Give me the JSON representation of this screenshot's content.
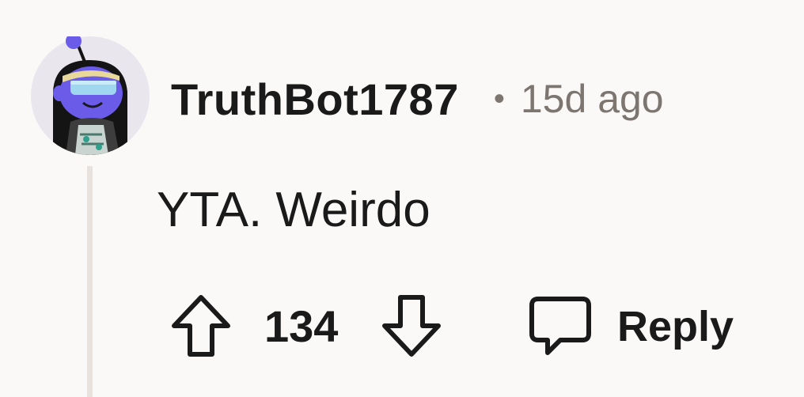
{
  "comment": {
    "author": "TruthBot1787",
    "separator": "•",
    "timestamp": "15d ago",
    "body": "YTA. Weirdo",
    "vote_count": "134",
    "reply_label": "Reply"
  },
  "icons": {
    "avatar": "snoo-avatar-icon",
    "upvote": "arrow-up-icon",
    "downvote": "arrow-down-icon",
    "reply": "speech-bubble-icon"
  },
  "colors": {
    "background": "#faf9f7",
    "text_primary": "#1a1a1b",
    "text_secondary": "#7c7570",
    "thread_line": "#e7e2de",
    "avatar_purple": "#6a5ce8"
  }
}
